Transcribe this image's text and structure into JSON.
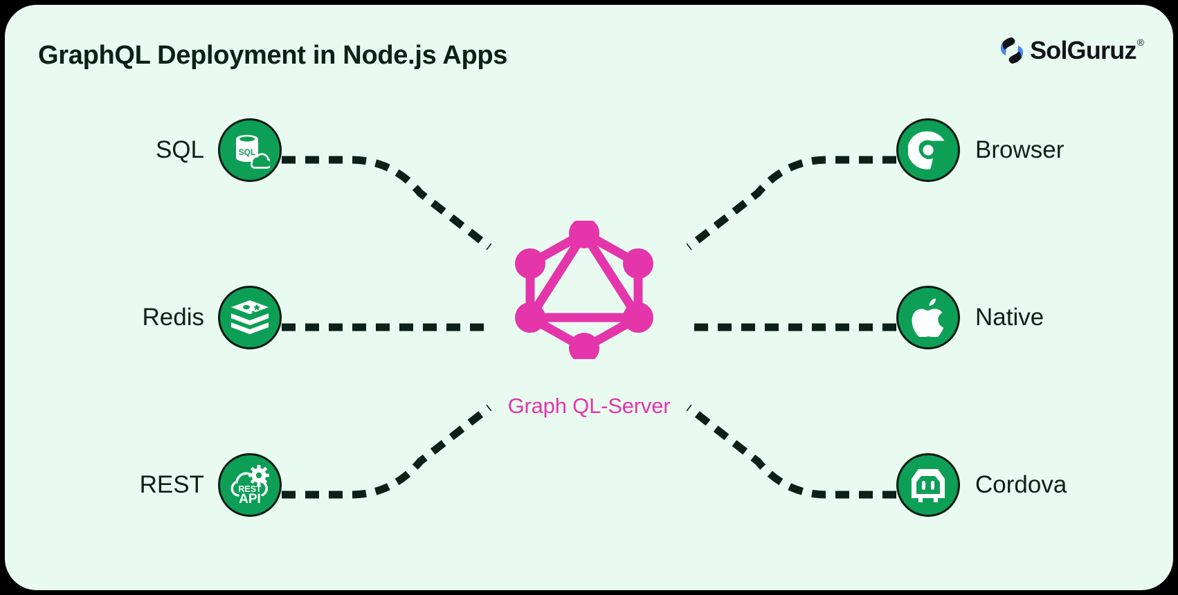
{
  "header": {
    "title": "GraphQL Deployment in Node.js Apps",
    "brand_name": "SolGuruz",
    "brand_registered_mark": "®",
    "brand_mark_icon": "solguruz-s-logo-icon"
  },
  "colors": {
    "page_background": "#000000",
    "card_background": "#E9FBF0",
    "icon_circle_green": "#0E9F56",
    "icon_circle_border": "#071A12",
    "title_text": "#0B2018",
    "graphql_pink": "#E535AB",
    "connector_dash": "#0B2018",
    "brand_mark_blue": "#4285F4",
    "brand_mark_dark": "#13131A"
  },
  "center": {
    "label": "Graph QL-Server",
    "icon": "graphql-logo-icon",
    "nodes": 6,
    "node_color": "#E535AB"
  },
  "left_nodes": [
    {
      "label": "SQL",
      "icon": "sql-database-cloud-icon"
    },
    {
      "label": "Redis",
      "icon": "redis-stack-icon"
    },
    {
      "label": "REST",
      "icon": "rest-api-cloud-gear-icon",
      "icon_text_top": "REST",
      "icon_text_bottom": "API"
    }
  ],
  "right_nodes": [
    {
      "label": "Browser",
      "icon": "chrome-browser-icon"
    },
    {
      "label": "Native",
      "icon": "apple-logo-icon"
    },
    {
      "label": "Cordova",
      "icon": "cordova-robot-icon"
    }
  ],
  "connectors": {
    "style": "dashed",
    "count": 6,
    "dash_pattern": "20 14"
  },
  "sql_icon_text": "SQL"
}
